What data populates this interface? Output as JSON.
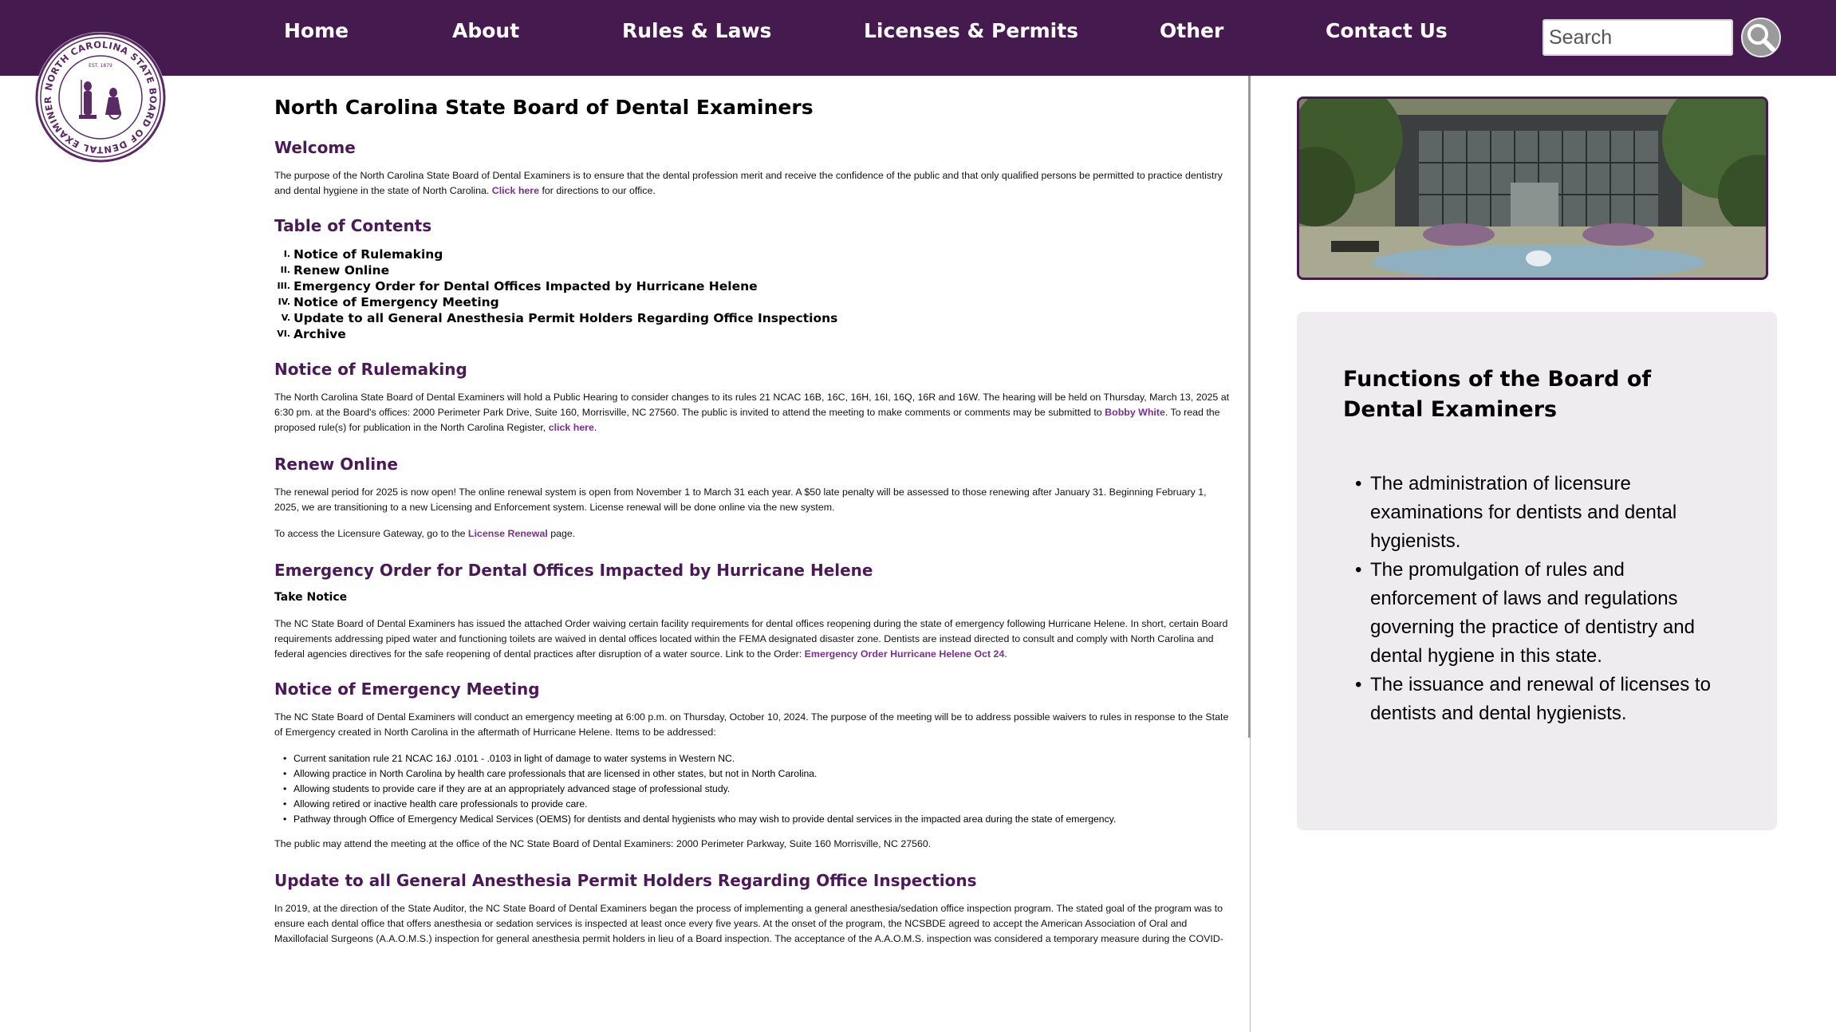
{
  "nav": {
    "items": [
      "Home",
      "About",
      "Rules & Laws",
      "Licenses & Permits",
      "Other",
      "Contact Us"
    ],
    "search_placeholder": "Search"
  },
  "seal": {
    "text": "NORTH CAROLINA STATE BOARD OF DENTAL EXAMINERS",
    "est": "EST. 1879"
  },
  "main": {
    "title": "North Carolina State Board of Dental Examiners",
    "welcome": {
      "heading": "Welcome",
      "text": "The purpose of the North Carolina State Board of Dental Examiners is to ensure that the dental profession merit and receive the confidence of the public and that only qualified persons be permitted to practice dentistry and dental hygiene in the state of North Carolina.",
      "link": "Click here",
      "after": "for directions to our office."
    },
    "toc": {
      "heading": "Table of Contents",
      "items": [
        {
          "num": "I.",
          "label": "Notice of Rulemaking"
        },
        {
          "num": "II.",
          "label": "Renew Online"
        },
        {
          "num": "III.",
          "label": "Emergency Order for Dental Offices Impacted by Hurricane Helene"
        },
        {
          "num": "IV.",
          "label": "Notice of Emergency Meeting"
        },
        {
          "num": "V.",
          "label": "Update to all General Anesthesia Permit Holders Regarding Office Inspections"
        },
        {
          "num": "VI.",
          "label": "Archive"
        }
      ]
    },
    "rulemaking": {
      "heading": "Notice of Rulemaking",
      "text": "The North Carolina State Board of Dental Examiners will hold a Public Hearing to consider changes to its rules 21 NCAC 16B, 16C, 16H, 16I, 16Q, 16R and 16W. The hearing will be held on Thursday, March 13, 2025 at 6:30 pm. at the Board's offices: 2000 Perimeter Park Drive, Suite 160, Morrisville, NC 27560. The public is invited to attend the meeting to make comments or comments may be submitted to",
      "link1": "Bobby White",
      "mid": ". To read the proposed rule(s) for publication in the North Carolina Register,",
      "link2": "click here",
      "end": "."
    },
    "renew": {
      "heading": "Renew Online",
      "text": "The renewal period for 2025 is now open! The online renewal system is open from November 1 to March 31 each year. A $50 late penalty will be assessed to those renewing after January 31. Beginning February 1, 2025, we are transitioning to a new Licensing and Enforcement system. License renewal will be done online via the new system.",
      "text2": "To access the Licensure Gateway, go to the",
      "link": "License Renewal",
      "after": "page."
    },
    "emergency_order": {
      "heading": "Emergency Order for Dental Offices Impacted by Hurricane Helene",
      "subheading": "Take Notice",
      "text": "The NC State Board of Dental Examiners has issued the attached Order waiving certain facility requirements for dental offices reopening during the state of emergency following Hurricane Helene. In short, certain Board requirements addressing piped water and functioning toilets are waived in dental offices located within the FEMA designated disaster zone. Dentists are instead directed to consult and comply with North Carolina and federal agencies directives for the safe reopening of dental practices after disruption of a water source. Link to the Order:",
      "link": "Emergency Order Hurricane Helene Oct 24",
      "end": "."
    },
    "emergency_meeting": {
      "heading": "Notice of Emergency Meeting",
      "text": "The NC State Board of Dental Examiners will conduct an emergency meeting at 6:00 p.m. on Thursday, October 10, 2024. The purpose of the meeting will be to address possible waivers to rules in response to the State of Emergency created in North Carolina in the aftermath of Hurricane Helene. Items to be addressed:",
      "items": [
        "Current sanitation rule 21 NCAC 16J .0101 - .0103 in light of damage to water systems in Western NC.",
        "Allowing practice in North Carolina by health care professionals that are licensed in other states, but not in North Carolina.",
        "Allowing students to provide care if they are at an appropriately advanced stage of professional study.",
        "Allowing retired or inactive health care professionals to provide care.",
        "Pathway through Office of Emergency Medical Services (OEMS) for dentists and dental hygienists who may wish to provide dental services in the impacted area during the state of emergency."
      ],
      "closing": "The public may attend the meeting at the office of the NC State Board of Dental Examiners: 2000 Perimeter Parkway, Suite 160 Morrisville, NC 27560."
    },
    "anesthesia": {
      "heading": "Update to all General Anesthesia Permit Holders Regarding Office Inspections",
      "text": "In 2019, at the direction of the State Auditor, the NC State Board of Dental Examiners began the process of implementing a general anesthesia/sedation office inspection program. The stated goal of the program was to ensure each dental office that offers anesthesia or sedation services is inspected at least once every five years. At the onset of the program, the NCSBDE agreed to accept the American Association of Oral and Maxillofacial Surgeons (A.A.O.M.S.) inspection for general anesthesia permit holders in lieu of a Board inspection. The acceptance of the A.A.O.M.S. inspection was considered a temporary measure during the COVID-"
    }
  },
  "sidebar": {
    "functions_title": "Functions of the Board of Dental Examiners",
    "functions": [
      "The administration of licensure examinations for dentists and dental hygienists.",
      "The promulgation of rules and enforcement of laws and regulations governing the practice of dentistry and dental hygiene in this state.",
      "The issuance and renewal of licenses to dentists and dental hygienists."
    ]
  },
  "colors": {
    "brand": "#451b4f",
    "heading": "#4a1a56",
    "link": "#7b2f8e",
    "card_bg": "#efecf0"
  }
}
